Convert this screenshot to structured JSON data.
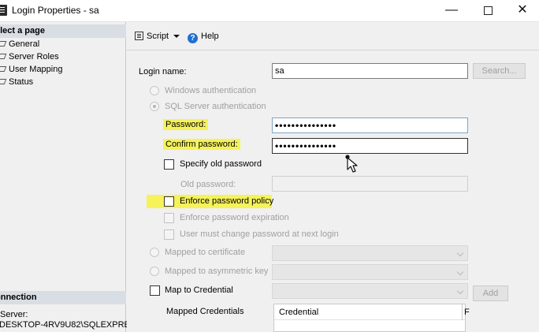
{
  "window": {
    "title": "Login Properties - sa",
    "minimize_glyph": "—",
    "close_glyph": "✕"
  },
  "left_pane": {
    "select_page_header": "elect a page",
    "pages": [
      {
        "label": "General"
      },
      {
        "label": "Server Roles"
      },
      {
        "label": "User Mapping"
      },
      {
        "label": "Status"
      }
    ],
    "connection_header": "onnection",
    "server_label": "Server:",
    "server_value": "DESKTOP-4RV9U82\\SQLEXPRE"
  },
  "toolbar": {
    "script_label": "Script",
    "help_label": "Help",
    "help_glyph": "?"
  },
  "form": {
    "login_name_label": "Login name:",
    "login_name_value": "sa",
    "search_button": "Search...",
    "windows_auth": "Windows authentication",
    "sql_auth": "SQL Server authentication",
    "password_label": "Password:",
    "password_value": "•••••••••••••••",
    "confirm_password_label": "Confirm password:",
    "confirm_password_value": "•••••••••••••••",
    "specify_old_password": "Specify old password",
    "old_password_label": "Old password:",
    "enforce_policy": "Enforce password policy",
    "enforce_expiration": "Enforce password expiration",
    "must_change": "User must change password at next login",
    "mapped_certificate": "Mapped to certificate",
    "mapped_asym_key": "Mapped to asymmetric key",
    "map_credential": "Map to Credential",
    "add_button": "Add",
    "mapped_credentials_label": "Mapped Credentials",
    "credential_column": "Credential",
    "provider_column_partial": "F"
  },
  "colors": {
    "highlight": "#f5f25a",
    "help_icon": "#1e6fd1",
    "pane_header": "#d9dde4"
  }
}
